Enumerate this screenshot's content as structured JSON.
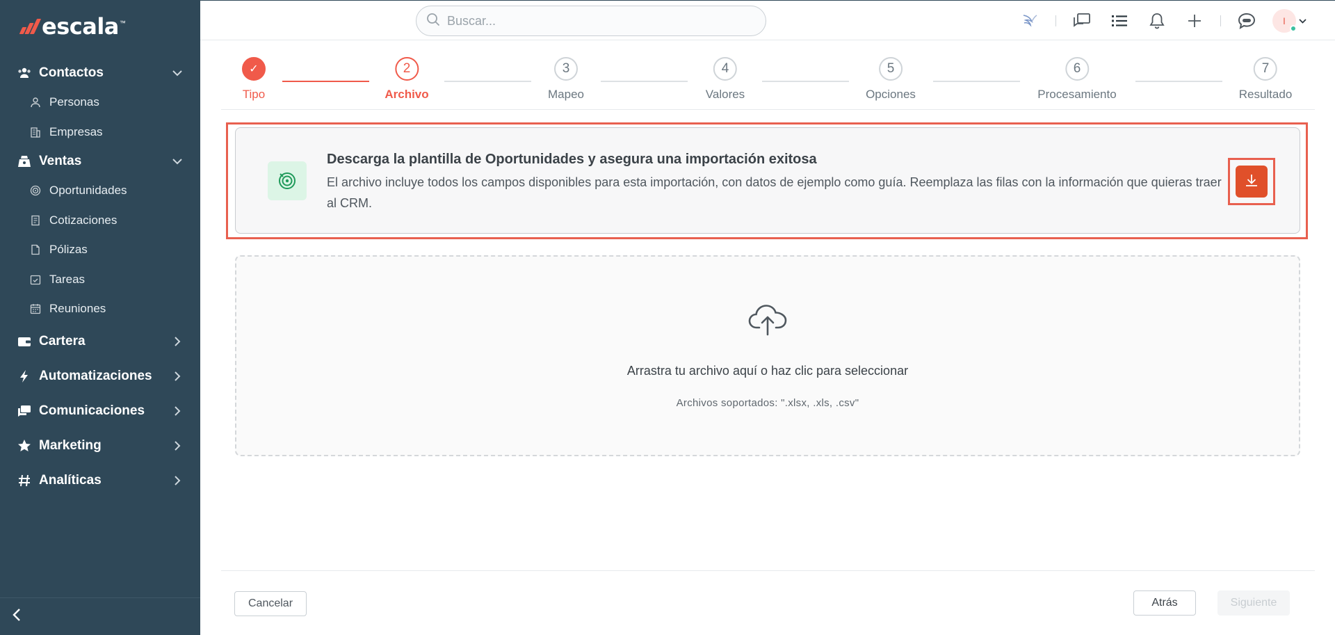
{
  "brand": {
    "name": "escala",
    "tm": "™"
  },
  "search": {
    "placeholder": "Buscar..."
  },
  "user": {
    "initial": "I"
  },
  "sidebar": {
    "sections": [
      {
        "label": "Contactos",
        "icon": "contacts-icon",
        "expanded": true,
        "items": [
          {
            "label": "Personas",
            "icon": "person-icon"
          },
          {
            "label": "Empresas",
            "icon": "building-icon"
          }
        ]
      },
      {
        "label": "Ventas",
        "icon": "sales-icon",
        "expanded": true,
        "items": [
          {
            "label": "Oportunidades",
            "icon": "target-icon"
          },
          {
            "label": "Cotizaciones",
            "icon": "quote-icon"
          },
          {
            "label": "Pólizas",
            "icon": "document-icon"
          },
          {
            "label": "Tareas",
            "icon": "task-check-icon"
          },
          {
            "label": "Reuniones",
            "icon": "calendar-icon"
          }
        ]
      },
      {
        "label": "Cartera",
        "icon": "wallet-icon",
        "expanded": false
      },
      {
        "label": "Automatizaciones",
        "icon": "lightning-icon",
        "expanded": false
      },
      {
        "label": "Comunicaciones",
        "icon": "chat-icon",
        "expanded": false
      },
      {
        "label": "Marketing",
        "icon": "star-icon",
        "expanded": false
      },
      {
        "label": "Analíticas",
        "icon": "hash-icon",
        "expanded": false
      }
    ]
  },
  "steps": [
    {
      "number": "✓",
      "label": "Tipo",
      "state": "done"
    },
    {
      "number": "2",
      "label": "Archivo",
      "state": "active"
    },
    {
      "number": "3",
      "label": "Mapeo",
      "state": "pending"
    },
    {
      "number": "4",
      "label": "Valores",
      "state": "pending"
    },
    {
      "number": "5",
      "label": "Opciones",
      "state": "pending"
    },
    {
      "number": "6",
      "label": "Procesamiento",
      "state": "pending"
    },
    {
      "number": "7",
      "label": "Resultado",
      "state": "pending"
    }
  ],
  "template": {
    "title": "Descarga la plantilla de Oportunidades y asegura una importación exitosa",
    "description": "El archivo incluye todos los campos disponibles para esta importación, con datos de ejemplo como guía. Reemplaza las filas con la información que quieras traer al CRM."
  },
  "dropzone": {
    "title": "Arrastra tu archivo aquí o haz clic para seleccionar",
    "subtitle": "Archivos soportados: \".xlsx, .xls, .csv\""
  },
  "footer": {
    "cancel": "Cancelar",
    "back": "Atrás",
    "next": "Siguiente"
  },
  "colors": {
    "sidebar": "#2f4858",
    "accent": "#f05a4a",
    "download": "#e0502a"
  }
}
